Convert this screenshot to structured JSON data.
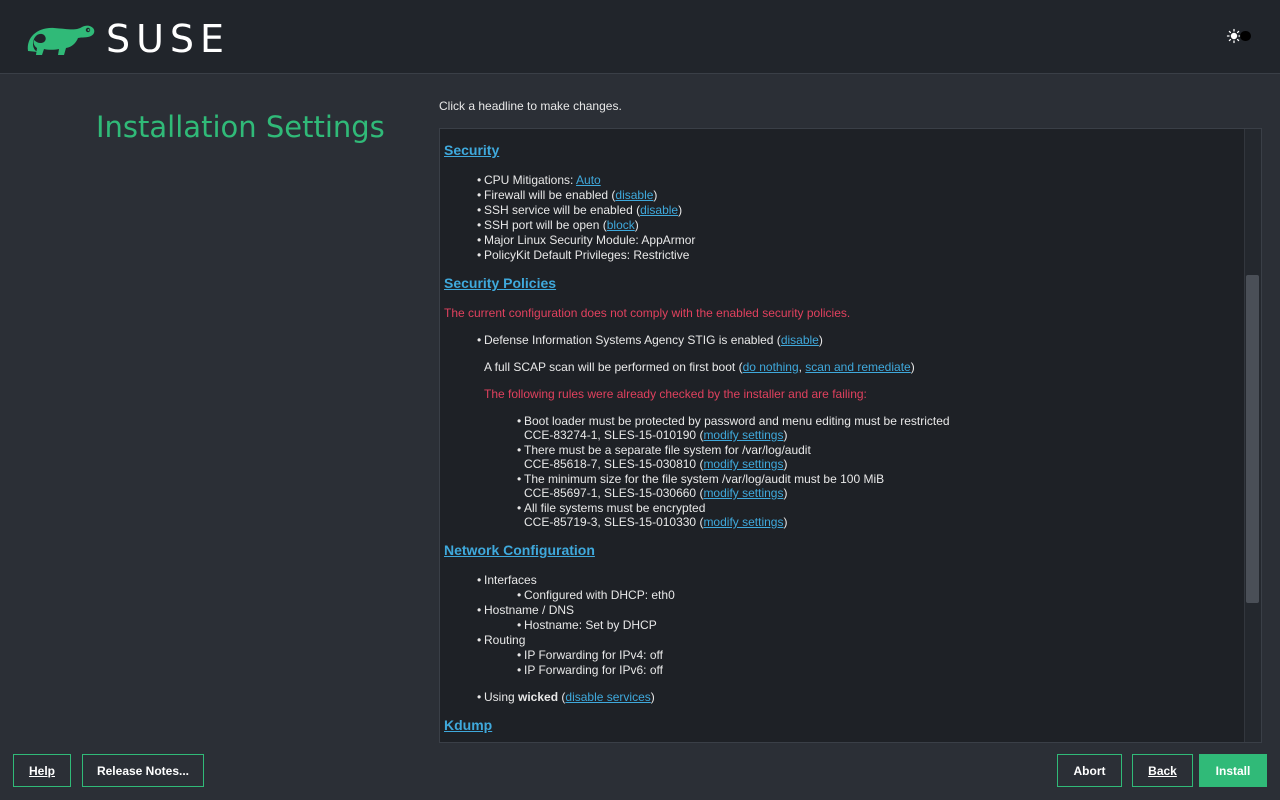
{
  "header": {
    "brand": "SUSE",
    "theme_toggle_icon": "sun-icon"
  },
  "page": {
    "title": "Installation Settings",
    "hint": "Click a headline to make changes."
  },
  "security": {
    "heading": "Security",
    "cpu_label": "CPU Mitigations: ",
    "cpu_value": "Auto",
    "firewall_label": "Firewall will be enabled (",
    "firewall_link": "disable",
    "ssh_service_label": "SSH service will be enabled (",
    "ssh_service_link": "disable",
    "ssh_port_label": "SSH port will be open (",
    "ssh_port_link": "block",
    "lsm": "Major Linux Security Module: AppArmor",
    "policykit": "PolicyKit Default Privileges: Restrictive",
    "close_paren": ")"
  },
  "security_policies": {
    "heading": "Security Policies",
    "warning": "The current configuration does not comply with the enabled security policies.",
    "stig_label": "Defense Information Systems Agency STIG is enabled (",
    "stig_link": "disable",
    "scap_label": "A full SCAP scan will be performed on first boot (",
    "scap_link1": "do nothing",
    "scap_sep": ", ",
    "scap_link2": "scan and remediate",
    "failing_intro": "The following rules were already checked by the installer and are failing:",
    "modify_link": "modify settings",
    "rules": [
      {
        "text": "Boot loader must be protected by password and menu editing must be restricted",
        "ids": "CCE-83274-1, SLES-15-010190 ("
      },
      {
        "text": "There must be a separate file system for /var/log/audit",
        "ids": "CCE-85618-7, SLES-15-030810 ("
      },
      {
        "text": "The minimum size for the file system /var/log/audit must be 100 MiB",
        "ids": "CCE-85697-1, SLES-15-030660 ("
      },
      {
        "text": "All file systems must be encrypted",
        "ids": "CCE-85719-3, SLES-15-010330 ("
      }
    ]
  },
  "network": {
    "heading": "Network Configuration",
    "interfaces": "Interfaces",
    "dhcp": "Configured with DHCP: eth0",
    "hostname_dns": "Hostname / DNS",
    "hostname": "Hostname: Set by DHCP",
    "routing": "Routing",
    "ipv4": "IP Forwarding for IPv4: off",
    "ipv6": "IP Forwarding for IPv6: off",
    "using_prefix": "Using ",
    "using_bold": "wicked",
    "using_mid": " (",
    "using_link": "disable services"
  },
  "kdump": {
    "heading": "Kdump"
  },
  "buttons": {
    "help": "Help",
    "release_notes": "Release Notes...",
    "abort": "Abort",
    "back": "Back",
    "install": "Install"
  },
  "colors": {
    "accent": "#30ba78",
    "link": "#3fa9dc",
    "error": "#e0415e"
  }
}
